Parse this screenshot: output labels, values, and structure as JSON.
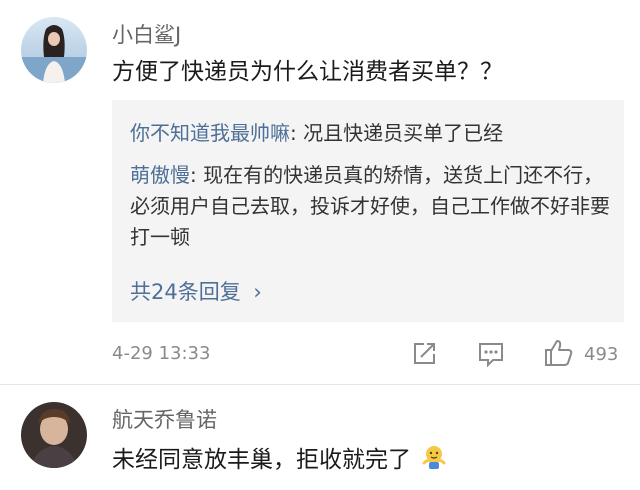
{
  "comments": [
    {
      "username": "小白鲨J",
      "text": "方便了快递员为什么让消费者买单？？",
      "replies": [
        {
          "name": "你不知道我最帅嘛",
          "sep": ": ",
          "text": "况且快递员买单了已经"
        },
        {
          "name": "萌傲慢",
          "sep": ": ",
          "text": "现在有的快递员真的矫情，送货上门还不行，必须用户自己去取，投诉才好使，自己工作做不好非要打一顿"
        }
      ],
      "more_label": "共24条回复",
      "more_chevron": "›",
      "time": "4-29 13:33",
      "like_count": "493",
      "icons": [
        "share-icon",
        "comment-icon",
        "like-icon"
      ]
    },
    {
      "username": "航天乔鲁诺",
      "text": "未经同意放丰巢，拒收就完了",
      "emoji_icon": "shrug-emoji-icon"
    }
  ],
  "colors": {
    "link": "#4e6f97",
    "meta": "#8a8a8a",
    "reply_bg": "#f4f4f4"
  }
}
